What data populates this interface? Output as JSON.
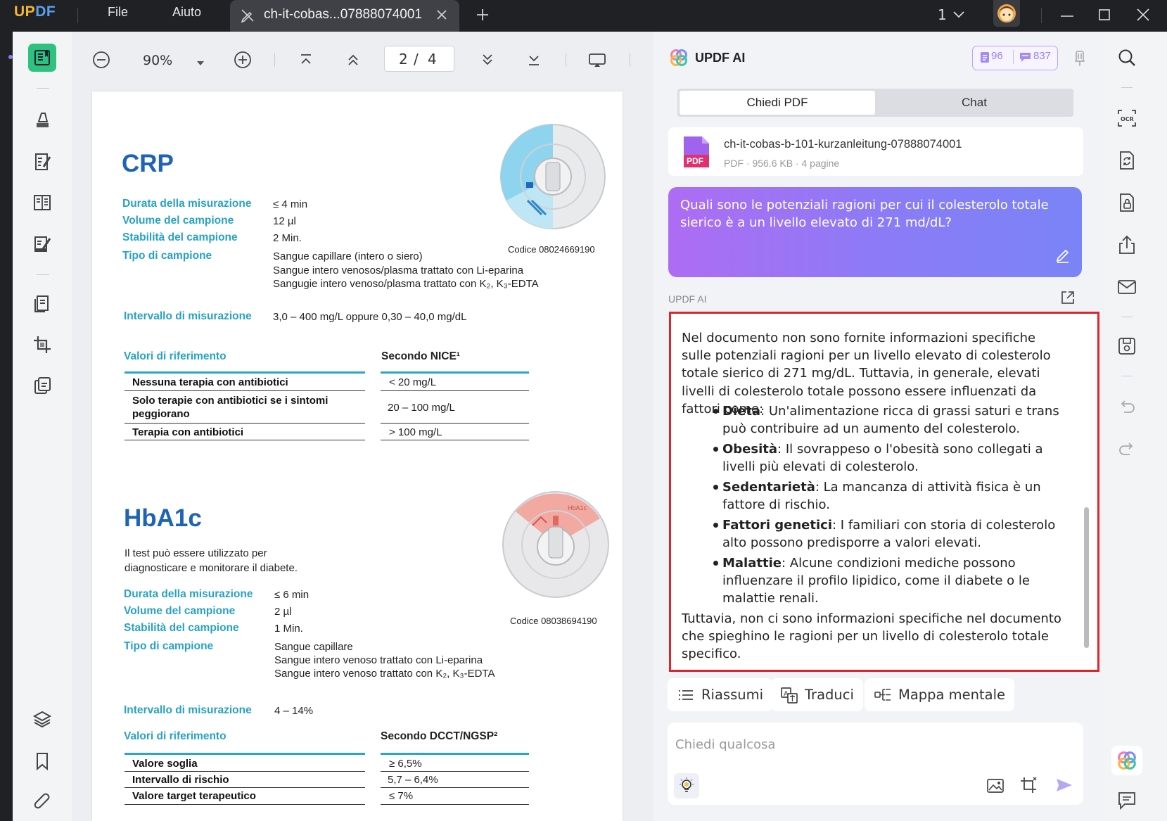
{
  "titlebar": {
    "logo": "UPDF",
    "menu": [
      "File",
      "Aiuto"
    ],
    "tab_title": "ch-it-cobas...07888074001",
    "page_count_indicator": "1"
  },
  "doc_toolbar": {
    "zoom": "90%",
    "page_current": "2",
    "page_separator": "/",
    "page_total": "4"
  },
  "document": {
    "crp": {
      "title": "CRP",
      "code": "Codice 08024669190",
      "fields": [
        {
          "label": "Durata della misurazione",
          "value": "≤ 4 min"
        },
        {
          "label": "Volume del campione",
          "value": "12 µl"
        },
        {
          "label": "Stabilità del campione",
          "value": "2 Min."
        }
      ],
      "sample_type_label": "Tipo di campione",
      "sample_type_values": [
        "Sangue capillare (intero o siero)",
        "Sangue intero venosos/plasma trattato con Li-eparina",
        "Sangugie intero venoso/plasma trattato con K₂, K₃-EDTA"
      ],
      "range_label": "Intervallo di misurazione",
      "range_value": "3,0 – 400 mg/L oppure 0,30 – 40,0 mg/dL",
      "ref_label": "Valori di riferimento",
      "ref_source": "Secondo NICE¹",
      "ref_rows": [
        {
          "name": "Nessuna terapia con antibiotici",
          "value": "< 20 mg/L"
        },
        {
          "name": "Solo terapie con antibiotici se i sintomi peggiorano",
          "value": "20 – 100 mg/L"
        },
        {
          "name": "Terapia con antibiotici",
          "value": "> 100 mg/L"
        }
      ]
    },
    "hba1c": {
      "title": "HbA1c",
      "intro": "Il test può essere utilizzato per diagnosticare e monitorare il diabete.",
      "code": "Codice 08038694190",
      "cartridge_label": "HbA1c",
      "fields": [
        {
          "label": "Durata della misurazione",
          "value": "≤ 6 min"
        },
        {
          "label": "Volume del campione",
          "value": "2 µl"
        },
        {
          "label": "Stabilità del campione",
          "value": "1 Min."
        }
      ],
      "sample_type_label": "Tipo di campione",
      "sample_type_values": [
        "Sangue capillare",
        "Sangue intero venoso trattato con Li-eparina",
        "Sangue intero venoso trattato con K₂, K₃-EDTA"
      ],
      "range_label": "Intervallo di misurazione",
      "range_value": "4 – 14%",
      "ref_label": "Valori di riferimento",
      "ref_source": "Secondo DCCT/NGSP²",
      "ref_rows": [
        {
          "name": "Valore soglia",
          "value": "≥ 6,5%"
        },
        {
          "name": "Intervallo di rischio",
          "value": "5,7 – 6,4%"
        },
        {
          "name": "Valore target terapeutico",
          "value": "≤ 7%"
        }
      ]
    }
  },
  "ai_panel": {
    "title": "UPDF AI",
    "credits_docs": "96",
    "credits_chat": "837",
    "tabs": [
      {
        "label": "Chiedi PDF",
        "active": true
      },
      {
        "label": "Chat",
        "active": false
      }
    ],
    "file": {
      "name": "ch-it-cobas-b-101-kurzanleitung-07888074001",
      "meta": "PDF · 956.6 KB · 4 pagine",
      "icon_label": "PDF"
    },
    "question": "Quali sono le potenziali ragioni per cui il colesterolo totale sierico è a un livello elevato di 271 md/dL?",
    "answer_sender": "UPDF AI",
    "answer": {
      "intro": "Nel documento non sono fornite informazioni specifiche sulle potenziali ragioni per un livello elevato di colesterolo totale sierico di 271 mg/dL. Tuttavia, in generale, elevati livelli di colesterolo totale possono essere influenzati da fattori come:",
      "items": [
        {
          "term": "Dieta",
          "text": ": Un'alimentazione ricca di grassi saturi e trans può contribuire ad un aumento del colesterolo."
        },
        {
          "term": "Obesità",
          "text": ": Il sovrappeso o l'obesità sono collegati a livelli più elevati di colesterolo."
        },
        {
          "term": "Sedentarietà",
          "text": ": La mancanza di attività fisica è un fattore di rischio."
        },
        {
          "term": "Fattori genetici",
          "text": ": I familiari con storia di colesterolo alto possono predisporre a valori elevati."
        },
        {
          "term": "Malattie",
          "text": ": Alcune condizioni mediche possono influenzare il profilo lipidico, come il diabete o le malattie renali."
        }
      ],
      "outro": "Tuttavia, non ci sono informazioni specifiche nel documento che spieghino le ragioni per un livello di colesterolo totale specifico."
    },
    "actions": {
      "summarize": "Riassumi",
      "translate": "Traduci",
      "mindmap": "Mappa mentale"
    },
    "input_placeholder": "Chiedi qualcosa"
  },
  "colors": {
    "accent_purple": "#8a7cf6",
    "highlight_red": "#e0232d",
    "doc_title_blue": "#1e63b4",
    "doc_label_teal": "#27a2c4",
    "tool_green": "#2ec27e"
  }
}
